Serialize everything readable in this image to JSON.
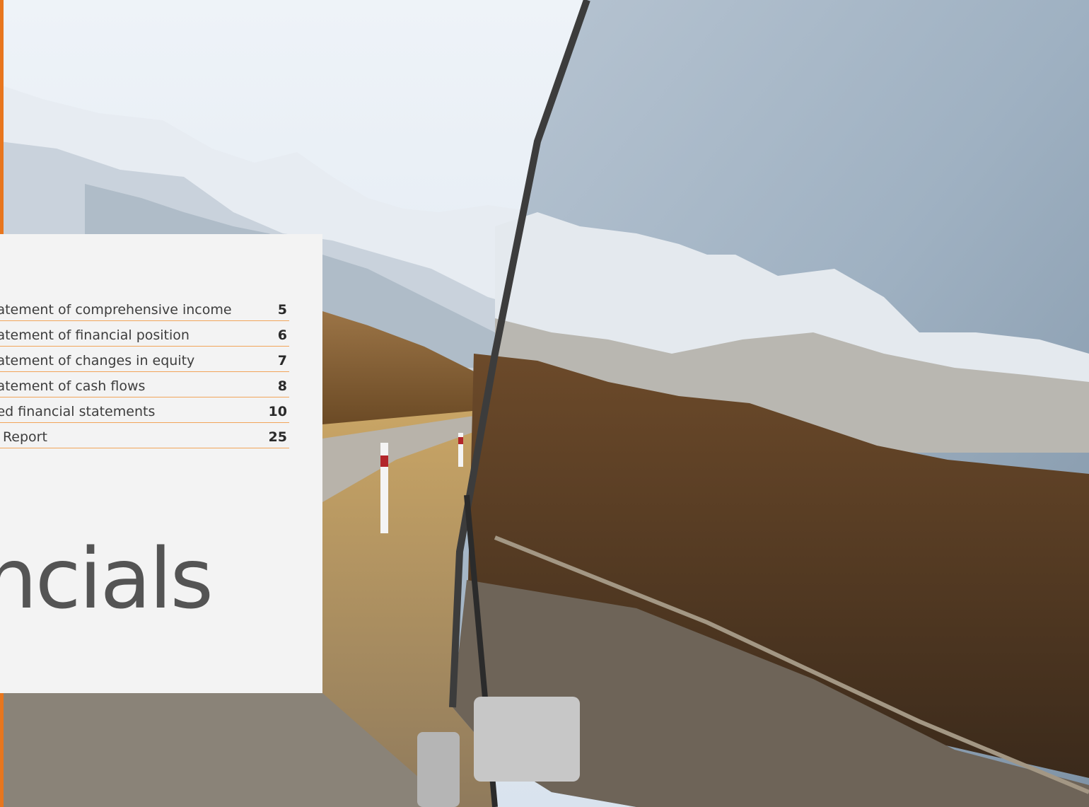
{
  "photo": {
    "description_icon": "landscape-photo-icon",
    "colors": {
      "sky": "#dfe9f2",
      "accent": "#e8761e",
      "panel": "#f3f3f3"
    }
  },
  "contents": {
    "items": [
      {
        "label": "tatement of comprehensive income",
        "page": "5"
      },
      {
        "label": "tatement of financial position",
        "page": "6"
      },
      {
        "label": "tatement of changes in equity",
        "page": "7"
      },
      {
        "label": "tatement of cash flows",
        "page": "8"
      },
      {
        "label": "ted financial statements",
        "page": "10"
      },
      {
        "label": "s Report",
        "page": "25"
      }
    ]
  },
  "section_title": "ncials"
}
